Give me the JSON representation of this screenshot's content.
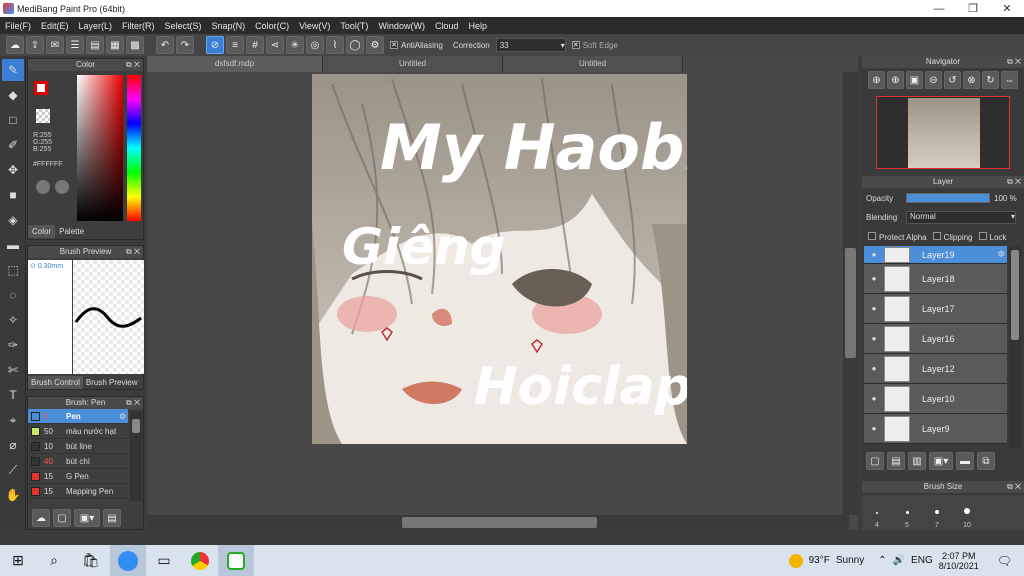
{
  "window": {
    "title": "MediBang Paint Pro (64bit)",
    "minimize": "—",
    "maximize": "❐",
    "close": "✕"
  },
  "menu": [
    "File(F)",
    "Edit(E)",
    "Layer(L)",
    "Filter(R)",
    "Select(S)",
    "Snap(N)",
    "Color(C)",
    "View(V)",
    "Tool(T)",
    "Window(W)",
    "Cloud",
    "Help"
  ],
  "toolbar": {
    "antialiasing_label": "AntiAliasing",
    "correction_label": "Correction",
    "correction_value": "33",
    "soft_edge_label": "Soft Edge"
  },
  "color_panel": {
    "title": "Color",
    "r": "R:255",
    "g": "G:255",
    "b": "B:255",
    "hex": "#FFFFFF",
    "tab_color": "Color",
    "tab_palette": "Palette"
  },
  "brush_preview": {
    "title": "Brush Preview",
    "size": "0.30mm",
    "tab_control": "Brush Control",
    "tab_preview": "Brush Preview"
  },
  "brush_list": {
    "title": "Brush: Pen",
    "items": [
      {
        "size": "5",
        "name": "Pen",
        "color": "#4d8ed8"
      },
      {
        "size": "50",
        "name": "màu nước hạt",
        "color": "#c8e86a"
      },
      {
        "size": "10",
        "name": "bút line",
        "color": "#333333"
      },
      {
        "size": "40",
        "name": "bút chì",
        "color": "#333333"
      },
      {
        "size": "15",
        "name": "G Pen",
        "color": "#e83030"
      },
      {
        "size": "15",
        "name": "Mapping Pen",
        "color": "#e83030"
      }
    ]
  },
  "doc_tabs": [
    "dsfsdf.mdp",
    "Untitled",
    "Untitled"
  ],
  "artwork_text": {
    "line1": "My Haobi",
    "line2": "Giêng",
    "line3": "Hoiclap"
  },
  "navigator": {
    "title": "Navigator"
  },
  "layer_panel": {
    "title": "Layer",
    "opacity_label": "Opacity",
    "opacity_value": "100 %",
    "opacity": 1.0,
    "blending_label": "Blending",
    "blending_value": "Normal",
    "protect_alpha": "Protect Alpha",
    "clipping": "Clipping",
    "lock": "Lock",
    "layers": [
      "Layer19",
      "Layer18",
      "Layer17",
      "Layer16",
      "Layer12",
      "Layer10",
      "Layer9"
    ]
  },
  "brush_size": {
    "title": "Brush Size",
    "sizes": [
      "4",
      "5",
      "7",
      "10"
    ]
  },
  "taskbar": {
    "weather_temp": "93°F",
    "weather_desc": "Sunny",
    "time": "2:07 PM",
    "date": "8/10/2021"
  }
}
